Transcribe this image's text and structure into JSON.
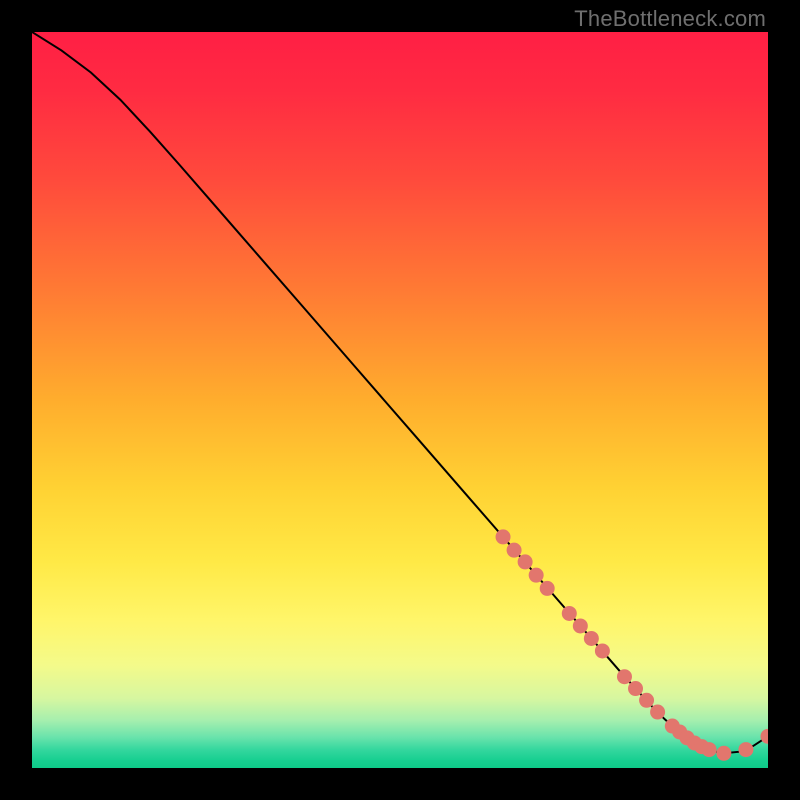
{
  "watermark": "TheBottleneck.com",
  "chart_data": {
    "type": "line",
    "title": "",
    "xlabel": "",
    "ylabel": "",
    "xlim": [
      0,
      100
    ],
    "ylim": [
      0,
      100
    ],
    "curve": {
      "x": [
        0,
        4,
        8,
        12,
        16,
        20,
        24,
        28,
        32,
        36,
        40,
        44,
        48,
        52,
        56,
        60,
        64,
        68,
        72,
        76,
        80,
        82,
        84,
        86,
        88,
        90,
        92,
        94,
        96,
        98,
        100
      ],
      "y": [
        100,
        97.5,
        94.5,
        90.8,
        86.5,
        82.0,
        77.4,
        72.8,
        68.2,
        63.6,
        59.0,
        54.4,
        49.8,
        45.2,
        40.6,
        36.0,
        31.4,
        26.8,
        22.2,
        17.6,
        13.0,
        10.8,
        8.6,
        6.6,
        4.8,
        3.4,
        2.4,
        2.0,
        2.2,
        3.0,
        4.3
      ]
    },
    "markers": [
      {
        "x": 64.0,
        "y": 31.4
      },
      {
        "x": 65.5,
        "y": 29.6
      },
      {
        "x": 67.0,
        "y": 28.0
      },
      {
        "x": 68.5,
        "y": 26.2
      },
      {
        "x": 70.0,
        "y": 24.4
      },
      {
        "x": 73.0,
        "y": 21.0
      },
      {
        "x": 74.5,
        "y": 19.3
      },
      {
        "x": 76.0,
        "y": 17.6
      },
      {
        "x": 77.5,
        "y": 15.9
      },
      {
        "x": 80.5,
        "y": 12.4
      },
      {
        "x": 82.0,
        "y": 10.8
      },
      {
        "x": 83.5,
        "y": 9.2
      },
      {
        "x": 85.0,
        "y": 7.6
      },
      {
        "x": 87.0,
        "y": 5.7
      },
      {
        "x": 88.0,
        "y": 4.9
      },
      {
        "x": 89.0,
        "y": 4.1
      },
      {
        "x": 90.0,
        "y": 3.4
      },
      {
        "x": 91.0,
        "y": 2.9
      },
      {
        "x": 92.0,
        "y": 2.5
      },
      {
        "x": 94.0,
        "y": 2.0
      },
      {
        "x": 97.0,
        "y": 2.5
      },
      {
        "x": 100.0,
        "y": 4.3
      }
    ],
    "gradient_stops": [
      {
        "offset": 0.0,
        "color": "#ff1f44"
      },
      {
        "offset": 0.08,
        "color": "#ff2b42"
      },
      {
        "offset": 0.2,
        "color": "#ff4a3c"
      },
      {
        "offset": 0.35,
        "color": "#ff7a34"
      },
      {
        "offset": 0.5,
        "color": "#ffad2d"
      },
      {
        "offset": 0.62,
        "color": "#ffd233"
      },
      {
        "offset": 0.72,
        "color": "#ffe946"
      },
      {
        "offset": 0.8,
        "color": "#fff66a"
      },
      {
        "offset": 0.86,
        "color": "#f4fa8a"
      },
      {
        "offset": 0.905,
        "color": "#d7f7a0"
      },
      {
        "offset": 0.935,
        "color": "#a6efae"
      },
      {
        "offset": 0.958,
        "color": "#6ae3ac"
      },
      {
        "offset": 0.975,
        "color": "#34d79e"
      },
      {
        "offset": 0.99,
        "color": "#16cf90"
      },
      {
        "offset": 1.0,
        "color": "#0fca89"
      }
    ],
    "marker_color": "#e2766d",
    "curve_color": "#000000"
  }
}
